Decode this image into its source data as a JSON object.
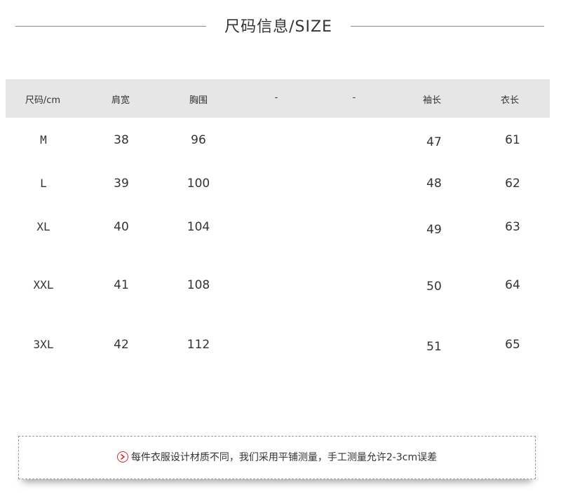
{
  "title": "尺码信息/SIZE",
  "table": {
    "headers": [
      "尺码/cm",
      "肩宽",
      "胸围",
      "-",
      "-",
      "袖长",
      "衣长"
    ],
    "rows": [
      {
        "size": "M",
        "shoulder": "38",
        "chest": "96",
        "sleeve": "47",
        "length": "61"
      },
      {
        "size": "L",
        "shoulder": "39",
        "chest": "100",
        "sleeve": "48",
        "length": "62"
      },
      {
        "size": "XL",
        "shoulder": "40",
        "chest": "104",
        "sleeve": "49",
        "length": "63"
      },
      {
        "size": "XXL",
        "shoulder": "41",
        "chest": "108",
        "sleeve": "50",
        "length": "64"
      },
      {
        "size": "3XL",
        "shoulder": "42",
        "chest": "112",
        "sleeve": "51",
        "length": "65"
      }
    ]
  },
  "note": {
    "icon": "chevron-right-circle-icon",
    "text": "每件衣服设计材质不同，我们采用平铺测量，手工测量允许2-3cm误差"
  },
  "colors": {
    "header_bg": "#e6e6e6",
    "icon_red": "#d9262b",
    "line": "#8a8a8a"
  }
}
